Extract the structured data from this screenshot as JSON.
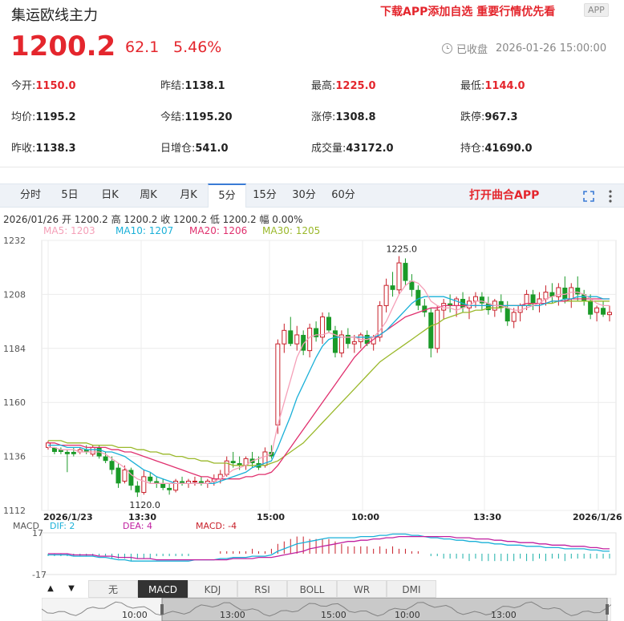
{
  "header": {
    "title": "集运欧线主力",
    "promo": "下载APP添加自选 重要行情优先看",
    "app_badge": "APP"
  },
  "quote": {
    "price": "1200.2",
    "change": "62.1",
    "change_pct": "5.46%",
    "status": "已收盘",
    "timestamp": "2026-01-26 15:00:00"
  },
  "stats": [
    [
      {
        "label": "今开:",
        "value": "1150.0",
        "red": true
      },
      {
        "label": "昨结:",
        "value": "1138.1",
        "red": false
      },
      {
        "label": "最高:",
        "value": "1225.0",
        "red": true
      },
      {
        "label": "最低:",
        "value": "1144.0",
        "red": true
      }
    ],
    [
      {
        "label": "均价:",
        "value": "1195.2",
        "red": false
      },
      {
        "label": "今结:",
        "value": "1195.20",
        "red": false
      },
      {
        "label": "涨停:",
        "value": "1308.8",
        "red": false
      },
      {
        "label": "跌停:",
        "value": "967.3",
        "red": false
      }
    ],
    [
      {
        "label": "昨收:",
        "value": "1138.3",
        "red": false
      },
      {
        "label": "日增仓:",
        "value": "541.0",
        "red": false
      },
      {
        "label": "成交量:",
        "value": "43172.0",
        "red": false
      },
      {
        "label": "持仓:",
        "value": "41690.0",
        "red": false
      }
    ]
  ],
  "tabs": [
    "分时",
    "5日",
    "日K",
    "周K",
    "月K",
    "5分",
    "15分",
    "30分",
    "60分"
  ],
  "active_tab": "5分",
  "open_app": "打开曲合APP",
  "kline_info": "2026/01/26  开 1200.2  高 1200.2  收 1200.2  低 1200.2  幅 0.00%",
  "ma_legend": [
    {
      "text": "MA5: 1203",
      "color": "#f5a0b8"
    },
    {
      "text": "MA10: 1207",
      "color": "#1ab0d8"
    },
    {
      "text": "MA20: 1206",
      "color": "#e0306e"
    },
    {
      "text": "MA30: 1205",
      "color": "#9ab82a"
    }
  ],
  "colors": {
    "up": "#c8202a",
    "down": "#1a9a28",
    "ma5": "#f5a0b8",
    "ma10": "#1ab0d8",
    "ma20": "#e0306e",
    "ma30": "#9ab82a",
    "dif": "#1ab0d8",
    "dea": "#c020a0"
  },
  "chart_data": {
    "type": "candlestick",
    "ylim": [
      1112,
      1232
    ],
    "y_ticks": [
      "1232",
      "1208",
      "1184",
      "1160",
      "1136",
      "1112"
    ],
    "x_labels": [
      "2026/1/23",
      "13:30",
      "15:00",
      "10:00",
      "13:30",
      "2026/1/26"
    ],
    "annotations": {
      "high": "1225.0",
      "low": "1120.0"
    },
    "candles": [
      [
        1140,
        1143,
        1139,
        1142
      ],
      [
        1140,
        1140,
        1137,
        1138
      ],
      [
        1139,
        1140,
        1137,
        1138
      ],
      [
        1138,
        1139,
        1129,
        1137
      ],
      [
        1138,
        1140,
        1136,
        1137
      ],
      [
        1138,
        1140,
        1137,
        1139
      ],
      [
        1139,
        1141,
        1137,
        1138
      ],
      [
        1137,
        1141,
        1136,
        1140
      ],
      [
        1140,
        1141,
        1135,
        1136
      ],
      [
        1136,
        1138,
        1133,
        1134
      ],
      [
        1134,
        1136,
        1128,
        1130
      ],
      [
        1131,
        1133,
        1122,
        1124
      ],
      [
        1125,
        1132,
        1124,
        1130
      ],
      [
        1130,
        1131,
        1121,
        1123
      ],
      [
        1123,
        1125,
        1118,
        1120
      ],
      [
        1120,
        1130,
        1119,
        1127
      ],
      [
        1127,
        1129,
        1124,
        1125
      ],
      [
        1125,
        1127,
        1122,
        1124
      ],
      [
        1124,
        1126,
        1121,
        1122
      ],
      [
        1122,
        1124,
        1119,
        1121
      ],
      [
        1121,
        1126,
        1120,
        1125
      ],
      [
        1125,
        1127,
        1123,
        1124
      ],
      [
        1124,
        1126,
        1122,
        1125
      ],
      [
        1125,
        1127,
        1123,
        1125
      ],
      [
        1125,
        1127,
        1123,
        1124
      ],
      [
        1124,
        1126,
        1122,
        1125
      ],
      [
        1125,
        1128,
        1123,
        1126
      ],
      [
        1126,
        1130,
        1124,
        1128
      ],
      [
        1128,
        1136,
        1127,
        1134
      ],
      [
        1134,
        1138,
        1131,
        1133
      ],
      [
        1133,
        1136,
        1130,
        1132
      ],
      [
        1132,
        1136,
        1130,
        1135
      ],
      [
        1135,
        1138,
        1131,
        1133
      ],
      [
        1133,
        1136,
        1130,
        1131
      ],
      [
        1132,
        1140,
        1131,
        1138
      ],
      [
        1138,
        1141,
        1135,
        1136
      ],
      [
        1150,
        1188,
        1146,
        1186
      ],
      [
        1186,
        1195,
        1182,
        1192
      ],
      [
        1192,
        1198,
        1185,
        1186
      ],
      [
        1186,
        1194,
        1183,
        1190
      ],
      [
        1190,
        1192,
        1181,
        1183
      ],
      [
        1183,
        1195,
        1180,
        1193
      ],
      [
        1193,
        1196,
        1187,
        1189
      ],
      [
        1189,
        1200,
        1186,
        1198
      ],
      [
        1198,
        1200,
        1191,
        1192
      ],
      [
        1192,
        1194,
        1180,
        1182
      ],
      [
        1182,
        1192,
        1180,
        1190
      ],
      [
        1190,
        1193,
        1184,
        1186
      ],
      [
        1186,
        1190,
        1182,
        1187
      ],
      [
        1187,
        1191,
        1184,
        1190
      ],
      [
        1190,
        1192,
        1185,
        1186
      ],
      [
        1186,
        1190,
        1183,
        1189
      ],
      [
        1189,
        1205,
        1187,
        1203
      ],
      [
        1203,
        1215,
        1200,
        1212
      ],
      [
        1212,
        1218,
        1207,
        1210
      ],
      [
        1210,
        1225,
        1208,
        1222
      ],
      [
        1222,
        1224,
        1212,
        1214
      ],
      [
        1214,
        1217,
        1207,
        1210
      ],
      [
        1210,
        1212,
        1201,
        1203
      ],
      [
        1203,
        1206,
        1198,
        1200
      ],
      [
        1200,
        1202,
        1180,
        1184
      ],
      [
        1184,
        1203,
        1182,
        1201
      ],
      [
        1201,
        1206,
        1197,
        1204
      ],
      [
        1204,
        1208,
        1200,
        1203
      ],
      [
        1203,
        1207,
        1198,
        1206
      ],
      [
        1206,
        1209,
        1200,
        1202
      ],
      [
        1202,
        1207,
        1197,
        1205
      ],
      [
        1205,
        1209,
        1202,
        1207
      ],
      [
        1207,
        1209,
        1201,
        1204
      ],
      [
        1204,
        1207,
        1199,
        1201
      ],
      [
        1201,
        1206,
        1198,
        1205
      ],
      [
        1205,
        1208,
        1200,
        1202
      ],
      [
        1202,
        1205,
        1194,
        1196
      ],
      [
        1196,
        1202,
        1193,
        1200
      ],
      [
        1200,
        1204,
        1196,
        1203
      ],
      [
        1203,
        1210,
        1201,
        1208
      ],
      [
        1208,
        1210,
        1201,
        1204
      ],
      [
        1204,
        1209,
        1200,
        1206
      ],
      [
        1206,
        1212,
        1203,
        1209
      ],
      [
        1209,
        1213,
        1204,
        1207
      ],
      [
        1207,
        1213,
        1203,
        1211
      ],
      [
        1211,
        1216,
        1204,
        1206
      ],
      [
        1206,
        1213,
        1202,
        1211
      ],
      [
        1211,
        1216,
        1205,
        1208
      ],
      [
        1208,
        1210,
        1203,
        1205
      ],
      [
        1205,
        1208,
        1197,
        1199
      ],
      [
        1200,
        1203,
        1196,
        1202
      ],
      [
        1202,
        1205,
        1198,
        1199
      ],
      [
        1199,
        1203,
        1196,
        1200
      ]
    ],
    "ma5": [
      1140,
      1140,
      1139,
      1139,
      1139,
      1138,
      1138,
      1138,
      1138,
      1137,
      1135,
      1133,
      1131,
      1128,
      1126,
      1125,
      1124,
      1124,
      1124,
      1124,
      1124,
      1124,
      1124,
      1124,
      1124,
      1124,
      1125,
      1126,
      1128,
      1130,
      1131,
      1132,
      1134,
      1135,
      1136,
      1137,
      1150,
      1160,
      1170,
      1180,
      1186,
      1189,
      1190,
      1190,
      1191,
      1190,
      1189,
      1189,
      1189,
      1188,
      1188,
      1189,
      1192,
      1196,
      1202,
      1208,
      1212,
      1214,
      1213,
      1210,
      1205,
      1203,
      1202,
      1202,
      1201,
      1202,
      1203,
      1205,
      1205,
      1204,
      1203,
      1203,
      1202,
      1201,
      1201,
      1202,
      1203,
      1204,
      1206,
      1207,
      1208,
      1208,
      1209,
      1209,
      1208,
      1206,
      1204,
      1203,
      1203
    ],
    "ma10": [
      1141,
      1141,
      1141,
      1140,
      1140,
      1140,
      1139,
      1139,
      1139,
      1138,
      1138,
      1137,
      1136,
      1134,
      1132,
      1130,
      1129,
      1127,
      1126,
      1125,
      1124,
      1124,
      1124,
      1124,
      1124,
      1124,
      1124,
      1125,
      1126,
      1127,
      1128,
      1129,
      1131,
      1132,
      1133,
      1134,
      1140,
      1147,
      1154,
      1162,
      1168,
      1174,
      1180,
      1185,
      1188,
      1189,
      1189,
      1189,
      1189,
      1189,
      1189,
      1189,
      1190,
      1192,
      1195,
      1198,
      1201,
      1204,
      1206,
      1207,
      1207,
      1207,
      1207,
      1206,
      1205,
      1204,
      1203,
      1203,
      1203,
      1203,
      1203,
      1203,
      1203,
      1203,
      1203,
      1203,
      1203,
      1203,
      1204,
      1205,
      1205,
      1206,
      1206,
      1207,
      1207,
      1207,
      1207,
      1206,
      1206
    ],
    "ma20": [
      1142,
      1142,
      1141,
      1141,
      1141,
      1141,
      1140,
      1140,
      1140,
      1140,
      1139,
      1139,
      1138,
      1138,
      1137,
      1136,
      1135,
      1134,
      1133,
      1132,
      1131,
      1130,
      1129,
      1128,
      1127,
      1127,
      1126,
      1126,
      1126,
      1126,
      1126,
      1127,
      1127,
      1128,
      1128,
      1129,
      1132,
      1136,
      1140,
      1144,
      1148,
      1152,
      1156,
      1160,
      1164,
      1168,
      1172,
      1176,
      1180,
      1183,
      1186,
      1188,
      1190,
      1192,
      1194,
      1196,
      1198,
      1199,
      1200,
      1201,
      1202,
      1202,
      1203,
      1203,
      1203,
      1203,
      1203,
      1203,
      1203,
      1203,
      1203,
      1203,
      1203,
      1203,
      1203,
      1204,
      1204,
      1204,
      1204,
      1205,
      1205,
      1205,
      1206,
      1206,
      1206,
      1206,
      1206,
      1206,
      1206
    ],
    "ma30": [
      1143,
      1143,
      1143,
      1142,
      1142,
      1142,
      1142,
      1141,
      1141,
      1141,
      1141,
      1140,
      1140,
      1140,
      1139,
      1139,
      1138,
      1138,
      1137,
      1137,
      1136,
      1136,
      1135,
      1135,
      1134,
      1134,
      1133,
      1133,
      1133,
      1132,
      1132,
      1132,
      1132,
      1132,
      1132,
      1133,
      1134,
      1136,
      1138,
      1140,
      1142,
      1145,
      1148,
      1151,
      1154,
      1157,
      1160,
      1163,
      1166,
      1169,
      1172,
      1175,
      1178,
      1180,
      1182,
      1184,
      1186,
      1188,
      1190,
      1192,
      1194,
      1195,
      1197,
      1198,
      1199,
      1200,
      1200,
      1201,
      1201,
      1202,
      1202,
      1202,
      1203,
      1203,
      1203,
      1203,
      1204,
      1204,
      1204,
      1204,
      1205,
      1205,
      1205,
      1205,
      1205,
      1205,
      1205,
      1205,
      1205
    ],
    "macd_legend": {
      "label": "MACD",
      "dif": "DIF: 2",
      "dea": "DEA: 4",
      "macd": "MACD: -4"
    },
    "macd_ticks": [
      "17",
      "-17"
    ],
    "dif": [
      -1,
      -1,
      -1,
      -1,
      -2,
      -2,
      -2,
      -2,
      -3,
      -3,
      -4,
      -5,
      -5,
      -6,
      -6,
      -6,
      -6,
      -6,
      -6,
      -6,
      -6,
      -6,
      -6,
      -5,
      -5,
      -5,
      -5,
      -4,
      -4,
      -3,
      -3,
      -3,
      -2,
      -2,
      -2,
      -1,
      2,
      4,
      6,
      8,
      9,
      10,
      11,
      12,
      13,
      13,
      13,
      13,
      13,
      14,
      14,
      14,
      15,
      15,
      16,
      16,
      16,
      15,
      15,
      14,
      13,
      13,
      12,
      12,
      11,
      11,
      10,
      10,
      9,
      9,
      8,
      8,
      7,
      7,
      7,
      6,
      6,
      6,
      5,
      5,
      5,
      4,
      4,
      4,
      4,
      3,
      3,
      2,
      2
    ],
    "dea": [
      0,
      0,
      0,
      0,
      -1,
      -1,
      -1,
      -1,
      -2,
      -2,
      -2,
      -3,
      -3,
      -3,
      -4,
      -4,
      -4,
      -5,
      -5,
      -5,
      -5,
      -5,
      -5,
      -5,
      -5,
      -5,
      -5,
      -5,
      -5,
      -4,
      -4,
      -4,
      -4,
      -3,
      -3,
      -3,
      -2,
      -1,
      0,
      1,
      2,
      4,
      5,
      6,
      7,
      8,
      9,
      10,
      10,
      11,
      11,
      12,
      12,
      13,
      13,
      14,
      14,
      14,
      14,
      14,
      14,
      14,
      14,
      14,
      13,
      13,
      13,
      12,
      12,
      12,
      11,
      11,
      10,
      10,
      9,
      9,
      9,
      8,
      8,
      7,
      7,
      7,
      6,
      6,
      6,
      5,
      5,
      4,
      4
    ],
    "scroll_labels": [
      "10:00",
      "13:00",
      "15:00",
      "10:00",
      "13:00"
    ]
  },
  "indicator_tabs": [
    "无",
    "MACD",
    "KDJ",
    "RSI",
    "BOLL",
    "WR",
    "DMI"
  ],
  "active_indicator": "MACD",
  "arrows": {
    "up": "▲",
    "down": "▼"
  }
}
